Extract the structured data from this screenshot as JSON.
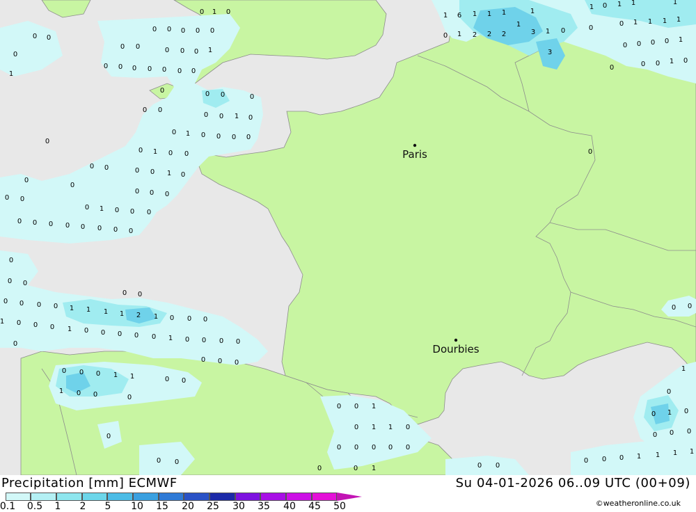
{
  "map": {
    "cities": [
      {
        "id": "paris",
        "name": "Paris"
      },
      {
        "id": "dourbies",
        "name": "Dourbies"
      }
    ],
    "values": [
      "0",
      "1",
      "2",
      "3",
      "6"
    ],
    "colors": {
      "sea": "#e8e8e8",
      "land": "#c8f5a2",
      "border": "#8c8c8c",
      "precip_light": "#d2f8f8",
      "precip_mid": "#a0ecf0",
      "precip_heavy": "#6fd2ea"
    }
  },
  "footer": {
    "title": "Precipitation [mm] ECMWF",
    "datetime": "Su 04-01-2026 06..09 UTC (00+09)",
    "credit": "©weatheronline.co.uk"
  },
  "legend": {
    "ticks": [
      "0.1",
      "0.5",
      "1",
      "2",
      "5",
      "10",
      "15",
      "20",
      "25",
      "30",
      "35",
      "40",
      "45",
      "50"
    ],
    "colors": [
      "#d2f8f8",
      "#b4f0f4",
      "#8ee6ee",
      "#6cd6ea",
      "#4cbce6",
      "#3aa0e0",
      "#2f7ad6",
      "#2a52c6",
      "#1c2aa8",
      "#7d12e0",
      "#a810e6",
      "#cc10e6",
      "#e410d8",
      "#c214b4"
    ]
  }
}
